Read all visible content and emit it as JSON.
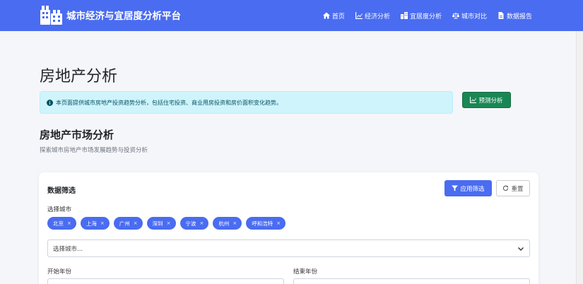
{
  "app": {
    "title": "城市经济与宜居度分析平台"
  },
  "nav": {
    "items": [
      {
        "label": "首页",
        "icon": "home-icon"
      },
      {
        "label": "经济分析",
        "icon": "chart-line-icon"
      },
      {
        "label": "宜居度分析",
        "icon": "building-icon"
      },
      {
        "label": "城市对比",
        "icon": "balance-scale-icon"
      },
      {
        "label": "数据报告",
        "icon": "file-icon"
      }
    ]
  },
  "page": {
    "title": "房地产分析",
    "alert": "本页面提供城市房地产投资趋势分析，包括住宅投资、商业用房投资和房价面积变化趋势。",
    "predict_label": "预测分析",
    "section_title": "房地产市场分析",
    "section_subtitle": "探索城市房地产市场发展趋势与投资分析"
  },
  "filter": {
    "title": "数据筛选",
    "apply_label": "应用筛选",
    "reset_label": "重置",
    "city_label": "选择城市",
    "cities": [
      "北京",
      "上海",
      "广州",
      "深圳",
      "宁波",
      "杭州",
      "呼和浩特"
    ],
    "tag_remove": "×",
    "city_select_placeholder": "选择城市...",
    "start_year_label": "开始年份",
    "end_year_label": "结束年份"
  },
  "colors": {
    "primary": "#4a6cf0",
    "success": "#198754",
    "info_bg": "#cff4fc"
  }
}
